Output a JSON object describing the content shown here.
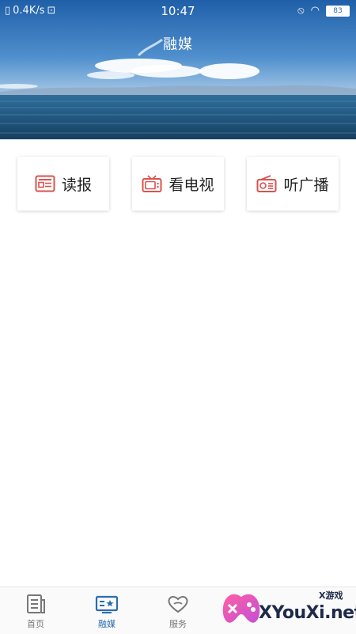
{
  "status_bar": {
    "network_speed": "0.4K/s",
    "time": "10:47",
    "battery": "83"
  },
  "header": {
    "title": "融媒"
  },
  "cards": [
    {
      "label": "读报",
      "icon": "newspaper-icon"
    },
    {
      "label": "看电视",
      "icon": "tv-icon"
    },
    {
      "label": "听广播",
      "icon": "radio-icon"
    }
  ],
  "tabbar": {
    "tabs": [
      {
        "label": "首页",
        "icon": "home-icon",
        "active": false
      },
      {
        "label": "融媒",
        "icon": "media-icon",
        "active": true
      },
      {
        "label": "服务",
        "icon": "service-icon",
        "active": false
      }
    ]
  },
  "watermark": {
    "text": "XYouXi.net",
    "sub": "X游戏"
  },
  "colors": {
    "accent": "#2b6cb0",
    "icon_red": "#d9534f"
  }
}
